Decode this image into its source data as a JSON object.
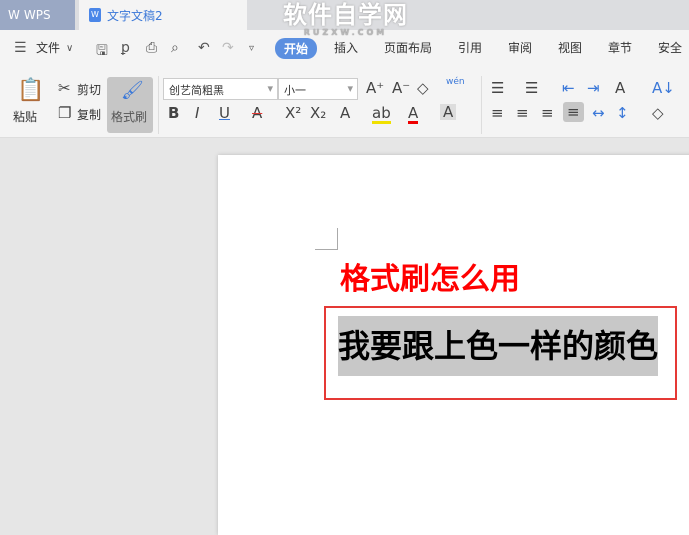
{
  "titlebar": {
    "app_tab": "WPS",
    "doc_tab": "文字文稿2",
    "watermark": "软件自学网",
    "watermark_sub": "RUZXW.COM"
  },
  "menu": {
    "file": "文件",
    "tabs": [
      "开始",
      "插入",
      "页面布局",
      "引用",
      "审阅",
      "视图",
      "章节",
      "安全"
    ]
  },
  "ribbon": {
    "paste": "粘贴",
    "cut": "剪切",
    "copy": "复制",
    "format_painter": "格式刷",
    "font": "创艺简粗黑",
    "size": "小一",
    "pinyin": "wén"
  },
  "document": {
    "heading": "格式刷怎么用",
    "highlighted_text": "我要跟上色一样的颜色"
  }
}
